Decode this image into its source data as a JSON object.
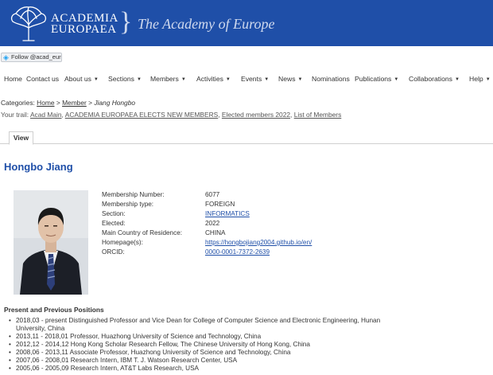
{
  "header": {
    "logo_line1": "ACADEMIA",
    "logo_line2": "EUROPAEA",
    "brace": "}",
    "tagline": "The Academy of Europe"
  },
  "follow_button": "Follow @acad_euro",
  "nav": [
    {
      "label": "Home",
      "dropdown": false
    },
    {
      "label": "Contact us",
      "dropdown": false
    },
    {
      "label": "About us",
      "dropdown": true
    },
    {
      "label": "Sections",
      "dropdown": true
    },
    {
      "label": "Members",
      "dropdown": true
    },
    {
      "label": "Activities",
      "dropdown": true
    },
    {
      "label": "Events",
      "dropdown": true
    },
    {
      "label": "News",
      "dropdown": true
    },
    {
      "label": "Nominations",
      "dropdown": false
    },
    {
      "label": "Publications",
      "dropdown": true
    },
    {
      "label": "Collaborations",
      "dropdown": true
    },
    {
      "label": "Help",
      "dropdown": true
    }
  ],
  "categories": {
    "label": "Categories:",
    "home": "Home",
    "member": "Member",
    "current": "Jiang Hongbo",
    "separator": ">"
  },
  "trail": {
    "label": "Your trail:",
    "items": [
      "Acad Main",
      "ACADEMIA EUROPAEA ELECTS NEW MEMBERS",
      "Elected members 2022",
      "List of Members"
    ]
  },
  "tab_view": "View",
  "member_name": "Hongbo Jiang",
  "details": [
    {
      "label": "Membership Number:",
      "value": "6077",
      "link": false
    },
    {
      "label": "Membership type:",
      "value": "FOREIGN",
      "link": false
    },
    {
      "label": "Section:",
      "value": "INFORMATICS",
      "link": true
    },
    {
      "label": "Elected:",
      "value": "2022",
      "link": false
    },
    {
      "label": "Main Country of Residence:",
      "value": "CHINA",
      "link": false
    },
    {
      "label": "Homepage(s):",
      "value": "https://hongbojiang2004.github.io/en/",
      "link": true
    },
    {
      "label": "ORCID:",
      "value": "0000-0001-7372-2639",
      "link": true
    }
  ],
  "positions_title": "Present and Previous Positions",
  "positions": [
    "2018,03 - present Distinguished Professor and Vice Dean for College of Computer Science and Electronic Engineering, Hunan University, China",
    "2013,11 - 2018,01 Professor, Huazhong University of Science and Technology, China",
    "2012,12 - 2014,12 Hong Kong Scholar Research Fellow, The Chinese University of Hong Kong, China",
    "2008,06 - 2013,11 Associate Professor, Huazhong University of Science and Technology, China",
    "2007,06 - 2008,01 Research Intern, IBM T. J. Watson Research Center, USA",
    "2005,06 - 2005,09 Research Intern, AT&T Labs Research, USA"
  ],
  "colors": {
    "banner": "#1f4fa8",
    "link_blue": "#1f4fa8",
    "twitter": "#1da1f2"
  }
}
